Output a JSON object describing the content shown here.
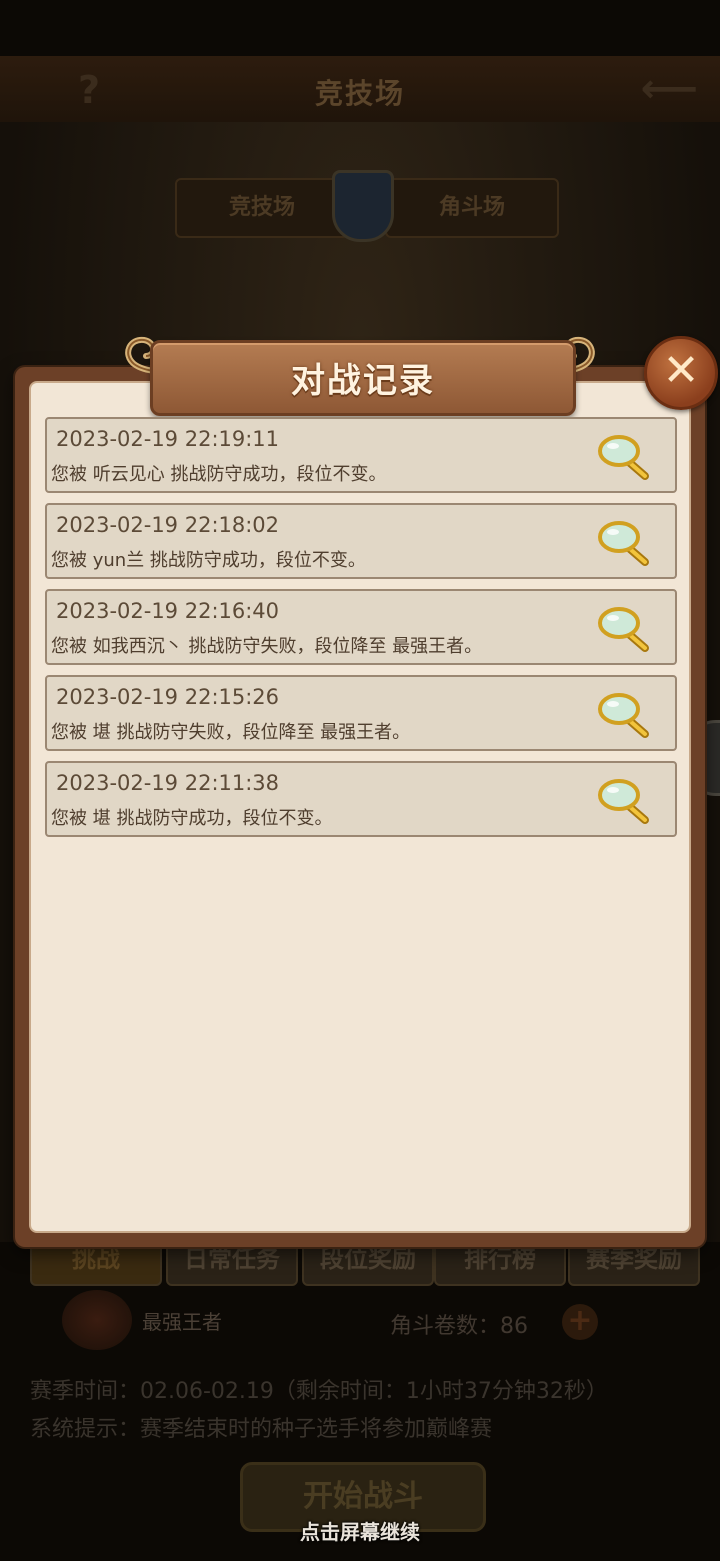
{
  "background": {
    "header_title": "竞技场",
    "arena_tabs": [
      "竞技场",
      "角斗场"
    ],
    "nav_tabs": [
      "挑战",
      "日常任务",
      "段位奖励",
      "排行榜",
      "赛季奖励"
    ],
    "rank_name": "最强王者",
    "token_label": "角斗卷数：86",
    "season_time": "赛季时间：02.06-02.19（剩余时间：1小时37分钟32秒）",
    "system_tip": "系统提示：赛季结束时的种子选手将参加巅峰赛",
    "start_button": "开始战斗",
    "continue_hint": "点击屏幕继续"
  },
  "dialog": {
    "title": "对战记录",
    "close_icon": "close-x-icon",
    "records": [
      {
        "time": "2023-02-19 22:19:11",
        "message": "您被 听云见心 挑战防守成功，段位不变。"
      },
      {
        "time": "2023-02-19 22:18:02",
        "message": "您被 yun兰 挑战防守成功，段位不变。"
      },
      {
        "time": "2023-02-19 22:16:40",
        "message": "您被 如我西沉丶 挑战防守失败，段位降至 最强王者。"
      },
      {
        "time": "2023-02-19 22:15:26",
        "message": "您被 堪 挑战防守失败，段位降至 最强王者。"
      },
      {
        "time": "2023-02-19 22:11:38",
        "message": "您被 堪 挑战防守成功，段位不变。"
      }
    ]
  },
  "colors": {
    "frame": "#6c4027",
    "panel": "#f2e6d6",
    "record_bg": "#e1d7c6",
    "banner": "#a66e45"
  }
}
